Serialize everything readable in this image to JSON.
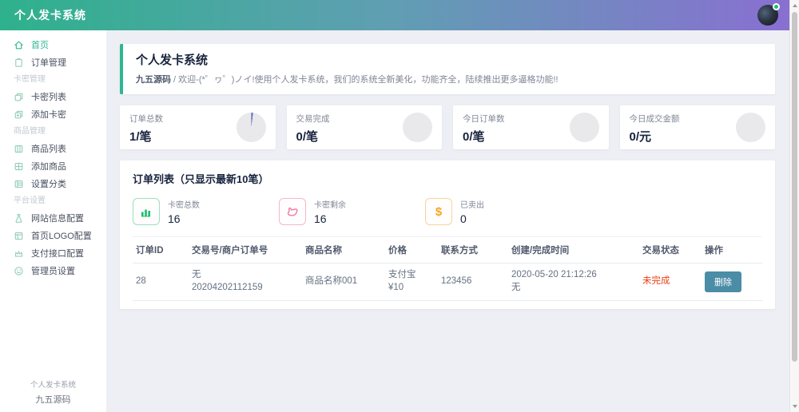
{
  "header": {
    "title": "个人发卡系统"
  },
  "sidebar": {
    "items": [
      {
        "label": "首页"
      },
      {
        "label": "订单管理"
      },
      {
        "label": "卡密管理"
      },
      {
        "label": "卡密列表"
      },
      {
        "label": "添加卡密"
      },
      {
        "label": "商品管理"
      },
      {
        "label": "商品列表"
      },
      {
        "label": "添加商品"
      },
      {
        "label": "设置分类"
      },
      {
        "label": "平台设置"
      },
      {
        "label": "网站信息配置"
      },
      {
        "label": "首页LOGO配置"
      },
      {
        "label": "支付接口配置"
      },
      {
        "label": "管理员设置"
      }
    ],
    "footer_line1": "个人发卡系统",
    "footer_line2": "九五源码"
  },
  "welcome": {
    "title": "个人发卡系统",
    "brand": "九五源码",
    "separator": " / ",
    "message": "欢迎-(*゜ヮ゜)ノイ!使用个人发卡系统，我们的系统全新美化，功能齐全，陆续推出更多逼格功能!!"
  },
  "stats": [
    {
      "label": "订单总数",
      "value": "1/笔"
    },
    {
      "label": "交易完成",
      "value": "0/笔"
    },
    {
      "label": "今日订单数",
      "value": "0/笔"
    },
    {
      "label": "今日成交金额",
      "value": "0/元"
    }
  ],
  "order_panel": {
    "title": "订单列表（只显示最新10笔）",
    "mini_stats": [
      {
        "label": "卡密总数",
        "value": "16"
      },
      {
        "label": "卡密剩余",
        "value": "16"
      },
      {
        "label": "已卖出",
        "value": "0"
      }
    ],
    "dollar_glyph": "$",
    "table": {
      "headers": [
        "订单ID",
        "交易号/商户订单号",
        "商品名称",
        "价格",
        "联系方式",
        "创建/完成时间",
        "交易状态",
        "操作"
      ],
      "rows": [
        {
          "order_id": "28",
          "trade_no_line1": "无",
          "trade_no_line2": "20204202112159",
          "product": "商品名称001",
          "price_line1": "支付宝",
          "price_line2": "¥10",
          "contact": "123456",
          "time_line1": "2020-05-20 21:12:26",
          "time_line2": "无",
          "status": "未完成",
          "action": "删除"
        }
      ]
    }
  },
  "colors": {
    "header_gradient_start": "#2eb18c",
    "header_gradient_end": "#8a6ed2",
    "accent_green": "#2db78f",
    "online_badge_green": "#19be6b",
    "pie_slice_blue": "#5a67c1",
    "mini_icon_green": "#19be6b",
    "mini_icon_pink": "#ed6ea0",
    "mini_icon_orange": "#f5a623",
    "status_red": "#ed3f14",
    "delete_button_teal": "#4b8ca6"
  }
}
